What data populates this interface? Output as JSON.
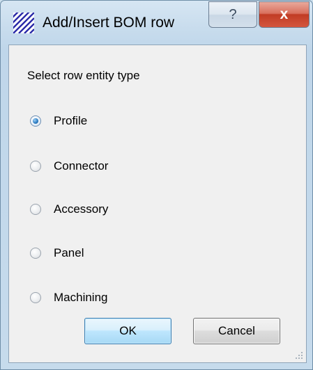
{
  "window": {
    "title": "Add/Insert BOM row",
    "help_glyph": "?",
    "close_glyph": "x",
    "icon": "striped-app-icon"
  },
  "dialog": {
    "prompt": "Select row entity type",
    "options": [
      {
        "label": "Profile",
        "checked": true
      },
      {
        "label": "Connector",
        "checked": false
      },
      {
        "label": "Accessory",
        "checked": false
      },
      {
        "label": "Panel",
        "checked": false
      },
      {
        "label": "Machining",
        "checked": false
      }
    ],
    "ok_label": "OK",
    "cancel_label": "Cancel"
  },
  "colors": {
    "accent": "#2f7fc4",
    "close_button": "#c13c24",
    "frame": "#c6dbec"
  }
}
